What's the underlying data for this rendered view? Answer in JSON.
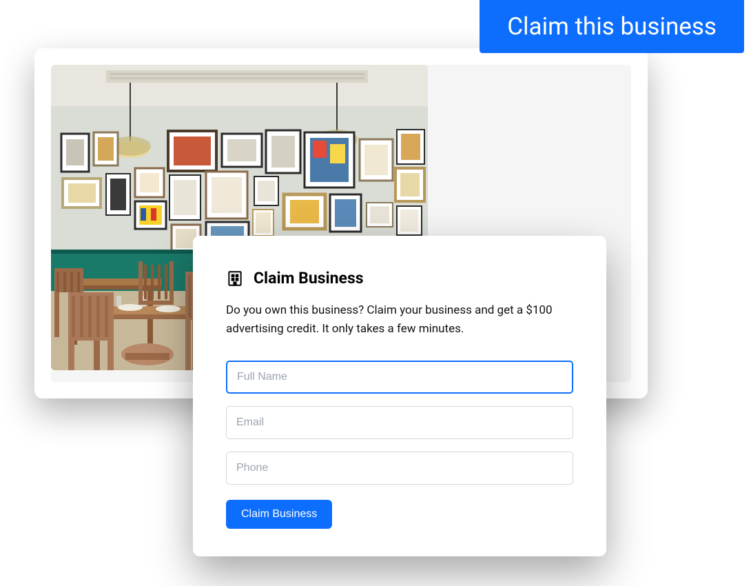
{
  "banner": {
    "text": "Claim this business"
  },
  "form": {
    "title": "Claim Business",
    "description": "Do you own this business? Claim your business and get a $100 advertising credit. It only takes a few minutes.",
    "fields": {
      "full_name": {
        "placeholder": "Full Name",
        "value": ""
      },
      "email": {
        "placeholder": "Email",
        "value": ""
      },
      "phone": {
        "placeholder": "Phone",
        "value": ""
      }
    },
    "submit_label": "Claim Business"
  },
  "icons": {
    "building": "building-icon"
  },
  "colors": {
    "primary": "#0d6efd"
  }
}
